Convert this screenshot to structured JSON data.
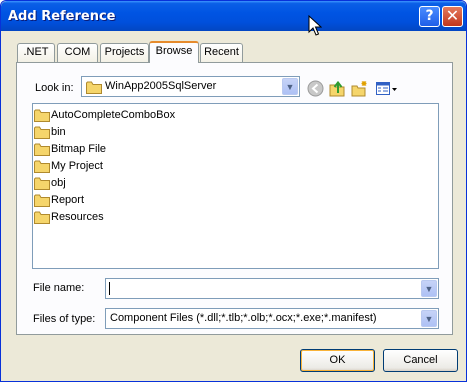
{
  "window": {
    "title": "Add Reference",
    "help_glyph": "?",
    "close_glyph": "✕"
  },
  "tabs": [
    {
      "label": ".NET",
      "active": false
    },
    {
      "label": "COM",
      "active": false
    },
    {
      "label": "Projects",
      "active": false
    },
    {
      "label": "Browse",
      "active": true
    },
    {
      "label": "Recent",
      "active": false
    }
  ],
  "look_in": {
    "label": "Look in:",
    "value": "WinApp2005SqlServer"
  },
  "toolbar": {
    "icons": [
      "back-icon",
      "up-folder-icon",
      "new-folder-icon",
      "view-menu-icon"
    ]
  },
  "files": [
    {
      "name": "AutoCompleteComboBox",
      "icon": "folder-icon"
    },
    {
      "name": "bin",
      "icon": "folder-icon"
    },
    {
      "name": "Bitmap File",
      "icon": "folder-icon"
    },
    {
      "name": "My Project",
      "icon": "folder-icon"
    },
    {
      "name": "obj",
      "icon": "folder-icon"
    },
    {
      "name": "Report",
      "icon": "folder-icon"
    },
    {
      "name": "Resources",
      "icon": "folder-icon"
    }
  ],
  "file_name": {
    "label": "File name:",
    "value": ""
  },
  "file_type": {
    "label": "Files of type:",
    "value": "Component Files (*.dll;*.tlb;*.olb;*.ocx;*.exe;*.manifest)"
  },
  "buttons": {
    "ok": "OK",
    "cancel": "Cancel"
  },
  "colors": {
    "title_bar": "#0054e3",
    "dialog_bg": "#ece9d8",
    "active_tab_accent": "#e68b2c",
    "folder": "#f5d56b"
  }
}
